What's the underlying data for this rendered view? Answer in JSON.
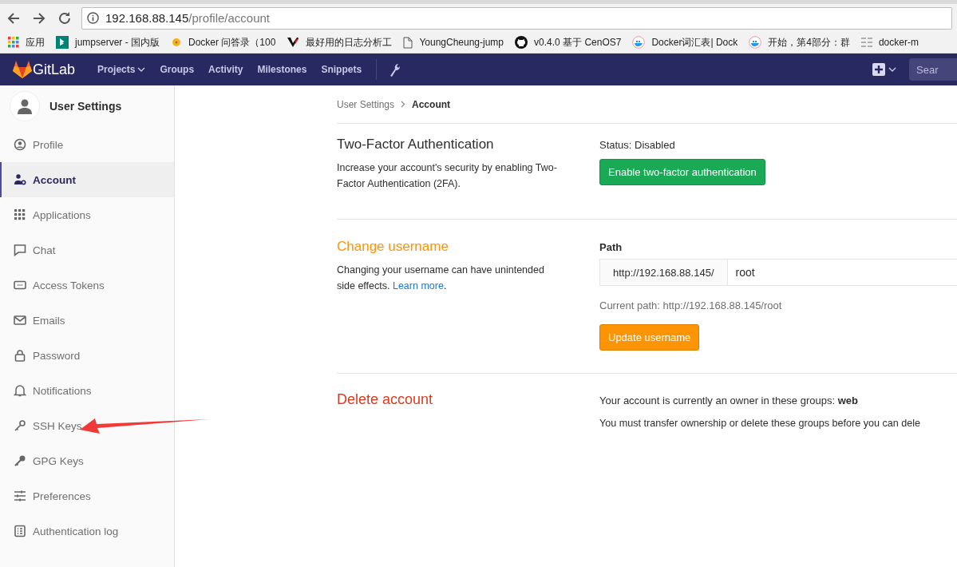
{
  "browser": {
    "url_host": "192.168.88.145",
    "url_path": "/profile/account",
    "bookmarks": [
      {
        "kind": "apps",
        "label": "应用"
      },
      {
        "kind": "bing",
        "label": "jumpserver - 国内版"
      },
      {
        "kind": "dot",
        "label": "Docker 问答录（100"
      },
      {
        "kind": "v",
        "label": "最好用的日志分析工"
      },
      {
        "kind": "page",
        "label": "YoungCheung-jump"
      },
      {
        "kind": "github",
        "label": "v0.4.0 基于 CenOS7"
      },
      {
        "kind": "docker",
        "label": "Docker词汇表| Dock"
      },
      {
        "kind": "docker",
        "label": "开始，第4部分：群"
      },
      {
        "kind": "list",
        "label": "docker-m"
      }
    ]
  },
  "navbar": {
    "logo": "GitLab",
    "search_placeholder": "Sear",
    "links": [
      {
        "label": "Projects",
        "dropdown": true
      },
      {
        "label": "Groups",
        "dropdown": false
      },
      {
        "label": "Activity",
        "dropdown": false
      },
      {
        "label": "Milestones",
        "dropdown": false
      },
      {
        "label": "Snippets",
        "dropdown": false
      }
    ]
  },
  "sidebar": {
    "title": "User Settings",
    "items": [
      {
        "label": "Profile",
        "selected": false
      },
      {
        "label": "Account",
        "selected": true
      },
      {
        "label": "Applications",
        "selected": false
      },
      {
        "label": "Chat",
        "selected": false
      },
      {
        "label": "Access Tokens",
        "selected": false
      },
      {
        "label": "Emails",
        "selected": false
      },
      {
        "label": "Password",
        "selected": false
      },
      {
        "label": "Notifications",
        "selected": false
      },
      {
        "label": "SSH Keys",
        "selected": false
      },
      {
        "label": "GPG Keys",
        "selected": false
      },
      {
        "label": "Preferences",
        "selected": false
      },
      {
        "label": "Authentication log",
        "selected": false
      }
    ]
  },
  "breadcrumb": [
    "User Settings",
    "Account"
  ],
  "two_factor": {
    "title": "Two-Factor Authentication",
    "description": "Increase your account's security by enabling Two-Factor Authentication (2FA).",
    "status": "Status: Disabled",
    "button": "Enable two-factor authentication"
  },
  "change_username": {
    "title": "Change username",
    "description": "Changing your username can have unintended side effects.",
    "link": "Learn more",
    "after_link": ".",
    "path_label": "Path",
    "prefix": "http://192.168.88.145/",
    "value": "root",
    "current_path": "Current path: http://192.168.88.145/root",
    "button": "Update username"
  },
  "delete_account": {
    "title": "Delete account",
    "owner_text": "Your account is currently an owner in these groups: **web**",
    "transfer_text": "You must transfer ownership or delete these groups before you can dele"
  },
  "annotations": [
    {
      "kind": "arrow"
    }
  ]
}
